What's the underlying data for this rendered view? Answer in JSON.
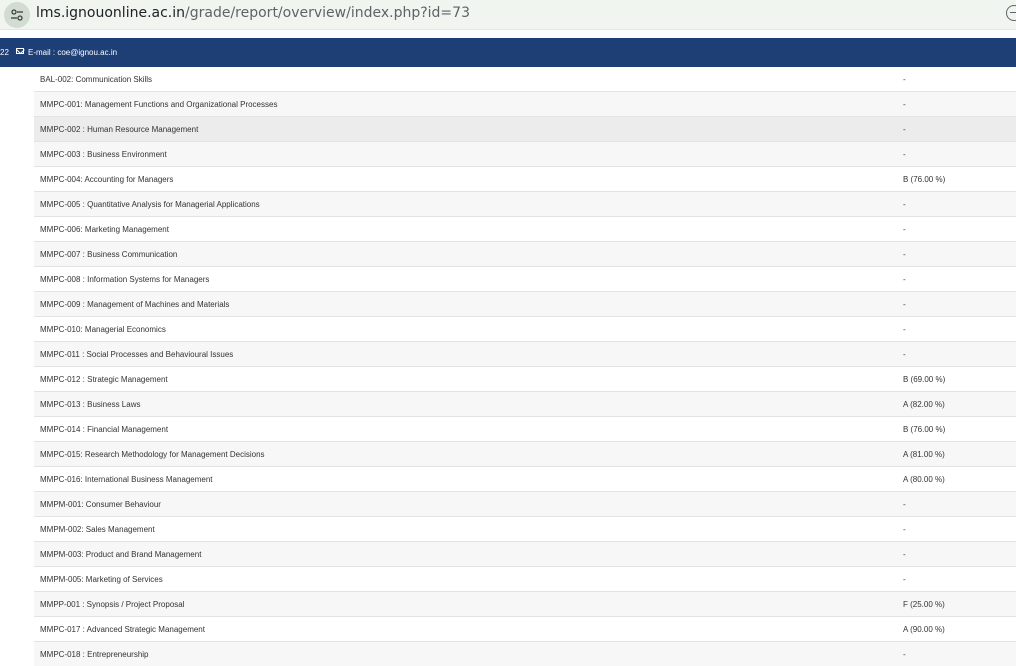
{
  "browser": {
    "url_host": "lms.ignouonline.ac.in",
    "url_path": "/grade/report/overview/index.php?id=73"
  },
  "info_bar": {
    "fragment": "22",
    "email_text": "E-mail : coe@ignou.ac.in"
  },
  "grades": {
    "rows": [
      {
        "course": "BAL-002: Communication Skills",
        "grade": "-"
      },
      {
        "course": "MMPC-001: Management Functions and Organizational Processes",
        "grade": "-"
      },
      {
        "course": "MMPC-002 : Human Resource Management",
        "grade": "-"
      },
      {
        "course": "MMPC-003 : Business Environment",
        "grade": "-"
      },
      {
        "course": "MMPC-004: Accounting for Managers",
        "grade": "B (76.00 %)"
      },
      {
        "course": "MMPC-005 : Quantitative Analysis for Managerial Applications",
        "grade": "-"
      },
      {
        "course": "MMPC-006: Marketing Management",
        "grade": "-"
      },
      {
        "course": "MMPC-007 : Business Communication",
        "grade": "-"
      },
      {
        "course": "MMPC-008 : Information Systems for Managers",
        "grade": "-"
      },
      {
        "course": "MMPC-009 : Management of Machines and Materials",
        "grade": "-"
      },
      {
        "course": "MMPC-010: Managerial Economics",
        "grade": "-"
      },
      {
        "course": "MMPC-011 : Social Processes and Behavioural Issues",
        "grade": "-"
      },
      {
        "course": "MMPC-012 : Strategic Management",
        "grade": "B (69.00 %)"
      },
      {
        "course": "MMPC-013 : Business Laws",
        "grade": "A (82.00 %)"
      },
      {
        "course": "MMPC-014 : Financial Management",
        "grade": "B (76.00 %)"
      },
      {
        "course": "MMPC-015: Research Methodology for Management Decisions",
        "grade": "A (81.00 %)"
      },
      {
        "course": "MMPC-016: International Business Management",
        "grade": "A (80.00 %)"
      },
      {
        "course": "MMPM-001: Consumer Behaviour",
        "grade": "-"
      },
      {
        "course": "MMPM-002: Sales Management",
        "grade": "-"
      },
      {
        "course": "MMPM-003: Product and Brand Management",
        "grade": "-"
      },
      {
        "course": "MMPM-005: Marketing of Services",
        "grade": "-"
      },
      {
        "course": "MMPP-001 : Synopsis / Project Proposal",
        "grade": "F (25.00 %)"
      },
      {
        "course": "MMPC-017 : Advanced Strategic Management",
        "grade": "A (90.00 %)"
      },
      {
        "course": "MMPC-018 : Entrepreneurship",
        "grade": "-"
      }
    ]
  }
}
